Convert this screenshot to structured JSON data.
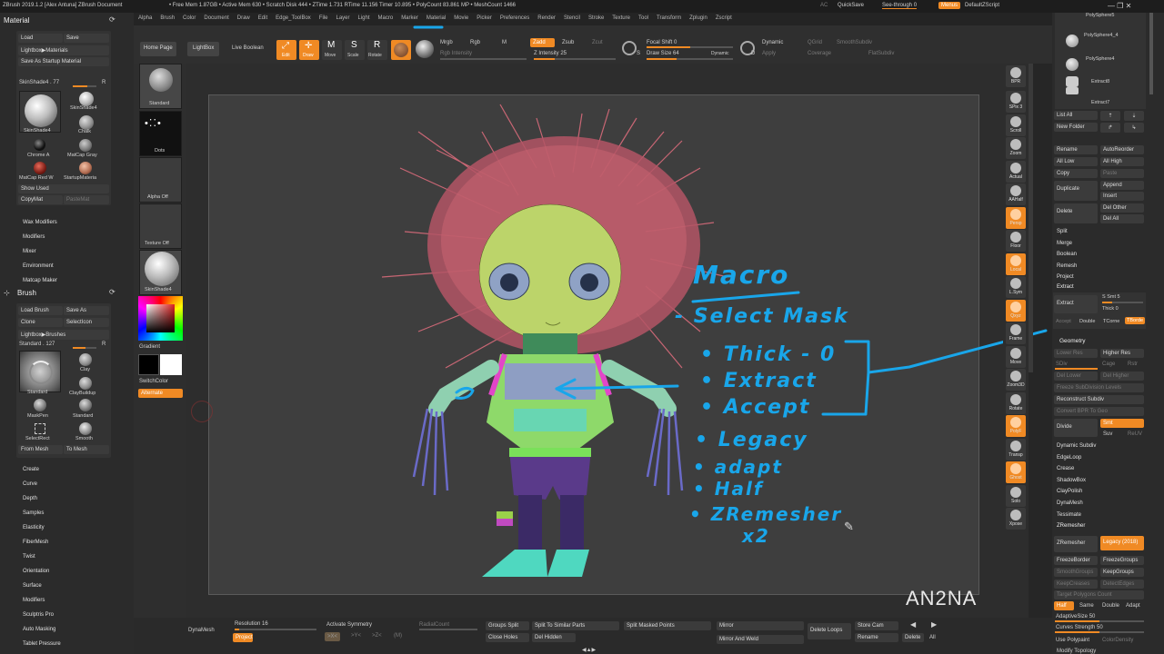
{
  "titlebar": {
    "title": "ZBrush 2019.1.2 [Alex Antuna]  ZBrush Document",
    "stats": "• Free Mem 1.87GB • Active Mem 630 • Scratch Disk 444 • ZTime 1.731 RTime 11.156 Timer 10.895 • PolyCount 83.861 MP • MeshCount 1466",
    "ac": "AC",
    "quicksave": "QuickSave",
    "seethrough": "See-through  0",
    "menus": "Menus",
    "default_script": "DefaultZScript"
  },
  "menubar": [
    "Alpha",
    "Brush",
    "Color",
    "Document",
    "Draw",
    "Edit",
    "Edge_ToolBox",
    "File",
    "Layer",
    "Light",
    "Macro",
    "Marker",
    "Material",
    "Movie",
    "Picker",
    "Preferences",
    "Render",
    "Stencil",
    "Stroke",
    "Texture",
    "Tool",
    "Transform",
    "Zplugin",
    "Zscript"
  ],
  "left_panel": {
    "material_title": "Material",
    "load": "Load",
    "save": "Save",
    "lightbox_materials": "Lightbox▶Materials",
    "save_startup": "Save As Startup Material",
    "skinshade_value": "SkinShade4 . 77",
    "r_label": "R",
    "materials": [
      "SkinShade4",
      "SkinShade4",
      "Chalk",
      "Chrome A",
      "MatCap Gray",
      "MatCap Red W",
      "StartupMateria"
    ],
    "show_used": "Show Used",
    "copymat": "CopyMat",
    "pastemat": "PasteMat",
    "sections": [
      "Wax Modifiers",
      "Modifiers",
      "Mixer",
      "Environment",
      "Matcap Maker"
    ],
    "brush_title": "Brush",
    "load_brush": "Load Brush",
    "save_as": "Save As",
    "clone": "Clone",
    "selecticon": "SelectIcon",
    "lightbox_brushes": "Lightbox▶Brushes",
    "standard_value": "Standard . 127",
    "brushes": [
      "Standard",
      "Clay",
      "ClayBuildup",
      "MaskPen",
      "Standard",
      "SelectRect",
      "Smooth"
    ],
    "from_mesh": "From Mesh",
    "to_mesh": "To Mesh",
    "brush_sections": [
      "Create",
      "Curve",
      "Depth",
      "Samples",
      "Elasticity",
      "FiberMesh",
      "Twist",
      "Orientation",
      "Surface",
      "Modifiers",
      "Sculptris Pro",
      "Auto Masking",
      "Tablet Pressure"
    ]
  },
  "shelf": {
    "items": [
      "Standard",
      "Dots",
      "Alpha Off",
      "Texture Off",
      "SkinShade4"
    ],
    "gradient": "Gradient",
    "switchcolor": "SwitchColor",
    "alternate": "Alternate"
  },
  "top_toolbar": {
    "home_page": "Home Page",
    "lightbox": "LightBox",
    "live_boolean": "Live Boolean",
    "modes": [
      "Edit",
      "Draw",
      "Move",
      "Scale",
      "Rotate"
    ],
    "mrgb": "Mrgb",
    "rgb": "Rgb",
    "m": "M",
    "zadd": "Zadd",
    "zsub": "Zsub",
    "zcut": "Zcut",
    "rgb_intensity": "Rgb Intensity",
    "z_intensity": "Z Intensity 25",
    "focal_shift": "Focal Shift 0",
    "draw_size": "Draw Size 64",
    "dynamic": "Dynamic",
    "dynamic2": "Dynamic",
    "apply": "Apply",
    "qgrid": "QGrid",
    "smoothsubdiv": "SmoothSubdiv",
    "coverage": "Coverage",
    "flatsubdiv": "FlatSubdiv",
    "s_label": "S",
    "d_label": "D"
  },
  "right_toolbar": [
    "BPR",
    "SPix 3",
    "Scroll",
    "Zoom",
    "Actual",
    "AAHalf",
    "Persp",
    "Floor",
    "Local",
    "L.Sym",
    "Qxyz",
    "Frame",
    "Move",
    "Zoom3D",
    "Rotate",
    "PolyF",
    "Transp",
    "Ghost",
    "Solo",
    "Xpose"
  ],
  "subtool_panel": {
    "items": [
      "PolySphere5",
      "PolySphere4_4",
      "PolySphere4",
      "Extract8",
      "Extract7"
    ],
    "list_all": "List All",
    "new_folder": "New Folder",
    "rename": "Rename",
    "autoreorder": "AutoReorder",
    "all_low": "All Low",
    "all_high": "All High",
    "copy": "Copy",
    "paste": "Paste",
    "duplicate": "Duplicate",
    "append": "Append",
    "insert": "Insert",
    "delete": "Delete",
    "del_other": "Del Other",
    "del_all": "Del All",
    "sections": [
      "Split",
      "Merge",
      "Boolean",
      "Remesh",
      "Project"
    ],
    "extract_title": "Extract",
    "extract_btn": "Extract",
    "s_smt": "S Smt 5",
    "thick": "Thick 0",
    "accept": "Accept",
    "double": "Double",
    "tcorner": "TCorne",
    "tborder": "TBorde",
    "geometry": "Geometry",
    "lower_res": "Lower Res",
    "higher_res": "Higher Res",
    "sdiv": "SDiv",
    "cage": "Cage",
    "rstr": "Rstr",
    "del_lower": "Del Lower",
    "del_higher": "Del Higher",
    "freeze_subdiv": "Freeze SubDivision Levels",
    "reconstruct": "Reconstruct Subdiv",
    "convert_bpr": "Convert BPR To Geo",
    "divide": "Divide",
    "smt": "Smt",
    "suv": "Suv",
    "reuv": "ReUV",
    "geo_sections": [
      "Dynamic Subdiv",
      "EdgeLoop",
      "Crease",
      "ShadowBox",
      "ClayPolish",
      "DynaMesh",
      "Tessimate"
    ],
    "zremesher_title": "ZRemesher",
    "zremesher_btn": "ZRemesher",
    "legacy": "Legacy (2018)",
    "freezeborder": "FreezeBorder",
    "freezegroups": "FreezeGroups",
    "smoothgroups": "SmoothGroups",
    "keepgroups": "KeepGroups",
    "keepcreases": "KeepCreases",
    "detectedges": "DetectEdges",
    "target_poly": "Target Polygons Count",
    "half": "Half",
    "same": "Same",
    "double2": "Double",
    "adapt": "Adapt",
    "adaptive_size": "AdaptiveSize 50",
    "curves_strength": "Curves Strength 50",
    "use_polypaint": "Use Polypaint",
    "colordensity": "ColorDensity",
    "modify_topology": "Modify Topology"
  },
  "bottom_bar": {
    "dynamesh": "DynaMesh",
    "resolution": "Resolution 16",
    "project": "Project",
    "activate_symmetry": "Activate Symmetry",
    "x": ">X<",
    "y": ">Y<",
    "z": ">Z<",
    "m": "(M)",
    "radialcount": "RadialCount",
    "groups_split": "Groups Split",
    "split_similar": "Split To Similar Parts",
    "split_masked": "Split Masked Points",
    "close_holes": "Close Holes",
    "del_hidden": "Del Hidden",
    "mirror": "Mirror",
    "mirror_weld": "Mirror And Weld",
    "delete_loops": "Delete Loops",
    "store_cam": "Store Cam",
    "rename": "Rename",
    "delete": "Delete",
    "all": "All"
  },
  "annotations": {
    "title": "Macro",
    "lines": [
      "- Select Mask",
      "• Thick - 0",
      "• Extract",
      "• Accept",
      "• Legacy",
      "• adapt",
      "• Half",
      "• ZRemesher",
      "x2"
    ],
    "watermark": "AN2NA",
    "stroke_color": "#19a6ea"
  },
  "colors": {
    "accent": "#f08a24",
    "panel": "#2b2b2b",
    "canvas": "#3e3e3e",
    "annotation": "#19a6ea"
  }
}
